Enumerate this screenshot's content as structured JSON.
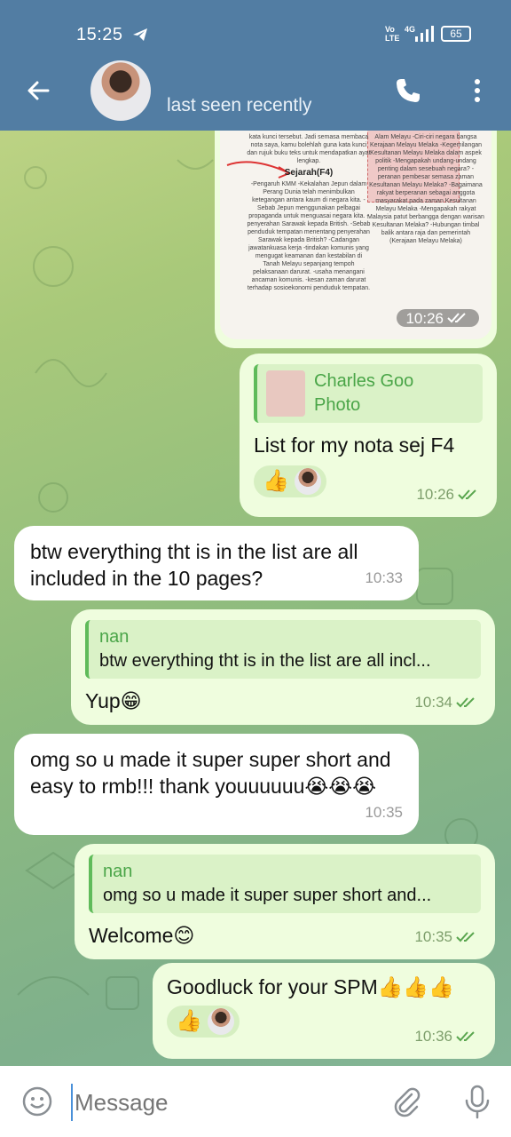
{
  "status_bar": {
    "time": "15:25",
    "volte": "Vo\nLTE",
    "network": "4G",
    "battery": "65"
  },
  "header": {
    "status_text": "last seen recently"
  },
  "photo_message": {
    "time": "10:26",
    "left_col_top": "kata kunci tersebut. Jadi semasa membaca nota saya, kamu bolehlah guna kata kunci dan rujuk buku teks untuk mendapatkan ayat lengkap.",
    "heading": "Sejarah(F4)",
    "left_col_body": "-Pengaruh KMM -Kekalahan Jepun dalam Perang Dunia telah menimbulkan ketegangan antara kaum di negara kita. -Sebab Jepun menggunakan pelbagai propaganda untuk menguasai negara kita. -penyerahan Sarawak kepada British. -Sebab penduduk tempatan menentang penyerahan Sarawak kepada British? -Cadangan jawatankuasa kerja -tindakan komunis yang mengugat keamanan dan kestabilan di Tanah Melayu sepanjang tempoh pelaksanaan darurat. -usaha menangani ancaman komunis. -kesan zaman darurat terhadap sosioekonomi penduduk tempatan.",
    "right_col_body": "Alam Melayu -Ciri-ciri negara bangsa Kerajaan Melayu Melaka -Kegemilangan Kesultanan Melayu Melaka dalam aspek politik -Mengapakah undang-undang penting dalam sesebuah negara? -peranan pembesar semasa zaman Kesultanan Melayu Melaka? -Bagaimana rakyat berperanan sebagai anggota masyarakat pada zaman Kesultanan Melayu Melaka -Mengapakah rakyat Malaysia patut berbangga dengan warisan Kesultanan Melaka? -Hubungan timbal balik antara raja dan pemerintah (Kerajaan Melayu Melaka)"
  },
  "messages": [
    {
      "reply_name": "Charles Goo",
      "reply_text": "Photo",
      "text": "List for my nota sej F4",
      "reaction": "👍",
      "time": "10:26"
    },
    {
      "text": "btw everything tht is in the list are all included in the 10 pages?",
      "time": "10:33"
    },
    {
      "reply_name": "nan",
      "reply_text": "btw everything tht is in the list are all incl...",
      "text": "Yup😁",
      "time": "10:34"
    },
    {
      "text": "omg so u made it super super short and easy to rmb!!! thank youuuuuu😭😭😭",
      "time": "10:35"
    },
    {
      "reply_name": "nan",
      "reply_text": "omg so u made it super super short and...",
      "text": "Welcome😊",
      "time": "10:35"
    },
    {
      "text": "Goodluck for your SPM👍👍👍",
      "reaction": "👍",
      "time": "10:36"
    }
  ],
  "input": {
    "placeholder": "Message"
  },
  "colors": {
    "header": "#527da3",
    "outgoing_bubble": "#effdde",
    "incoming_bubble": "#ffffff",
    "accent_green": "#4aa548"
  }
}
